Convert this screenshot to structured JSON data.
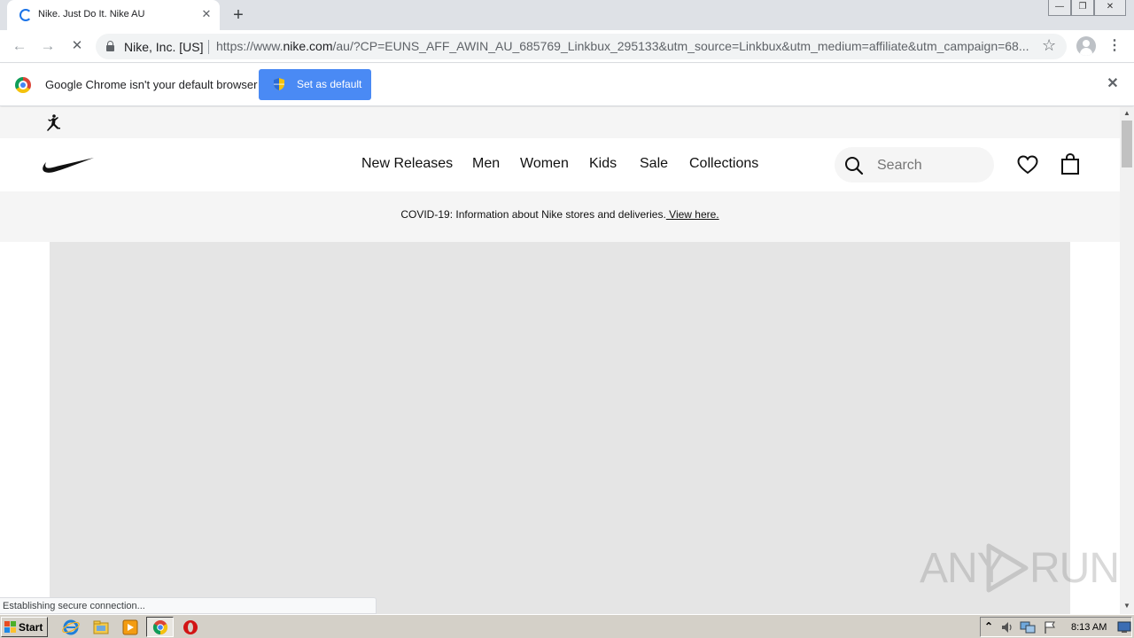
{
  "browser": {
    "tab_title": "Nike. Just Do It. Nike AU",
    "tab_close": "✕",
    "new_tab": "+",
    "window_controls": {
      "minimize": "—",
      "restore": "❐",
      "close": "✕"
    },
    "back": "←",
    "forward": "→",
    "reload": "✕",
    "site_identity": "Nike, Inc. [US]",
    "url_scheme": "https://www.",
    "url_host": "nike.com",
    "url_path": "/au/?CP=EUNS_AFF_AWIN_AU_685769_Linkbux_295133&utm_source=Linkbux&utm_medium=affiliate&utm_campaign=68...",
    "bookmark_star": "☆",
    "menu_dots": "⋮"
  },
  "infobar": {
    "message": "Google Chrome isn't your default browser",
    "button_label": "Set as default",
    "close": "✕"
  },
  "nike": {
    "nav_links": [
      "New Releases",
      "Men",
      "Women",
      "Kids",
      "Sale",
      "Collections"
    ],
    "search_placeholder": "Search",
    "banner_text": "COVID-19: Information about Nike stores and deliveries.",
    "banner_link": " View here."
  },
  "status_bar": {
    "text": "Establishing secure connection..."
  },
  "taskbar": {
    "start_label": "Start",
    "clock": "8:13 AM",
    "tray_up": "⌃"
  },
  "watermark": {
    "left": "ANY",
    "right": "RUN"
  },
  "scrollbar": {
    "up": "▲",
    "down": "▼"
  },
  "colors": {
    "accent_blue": "#4a8af4",
    "tab_strip": "#dee1e6",
    "hero_gray": "#e5e5e5",
    "taskbar": "#d4d0c8"
  }
}
